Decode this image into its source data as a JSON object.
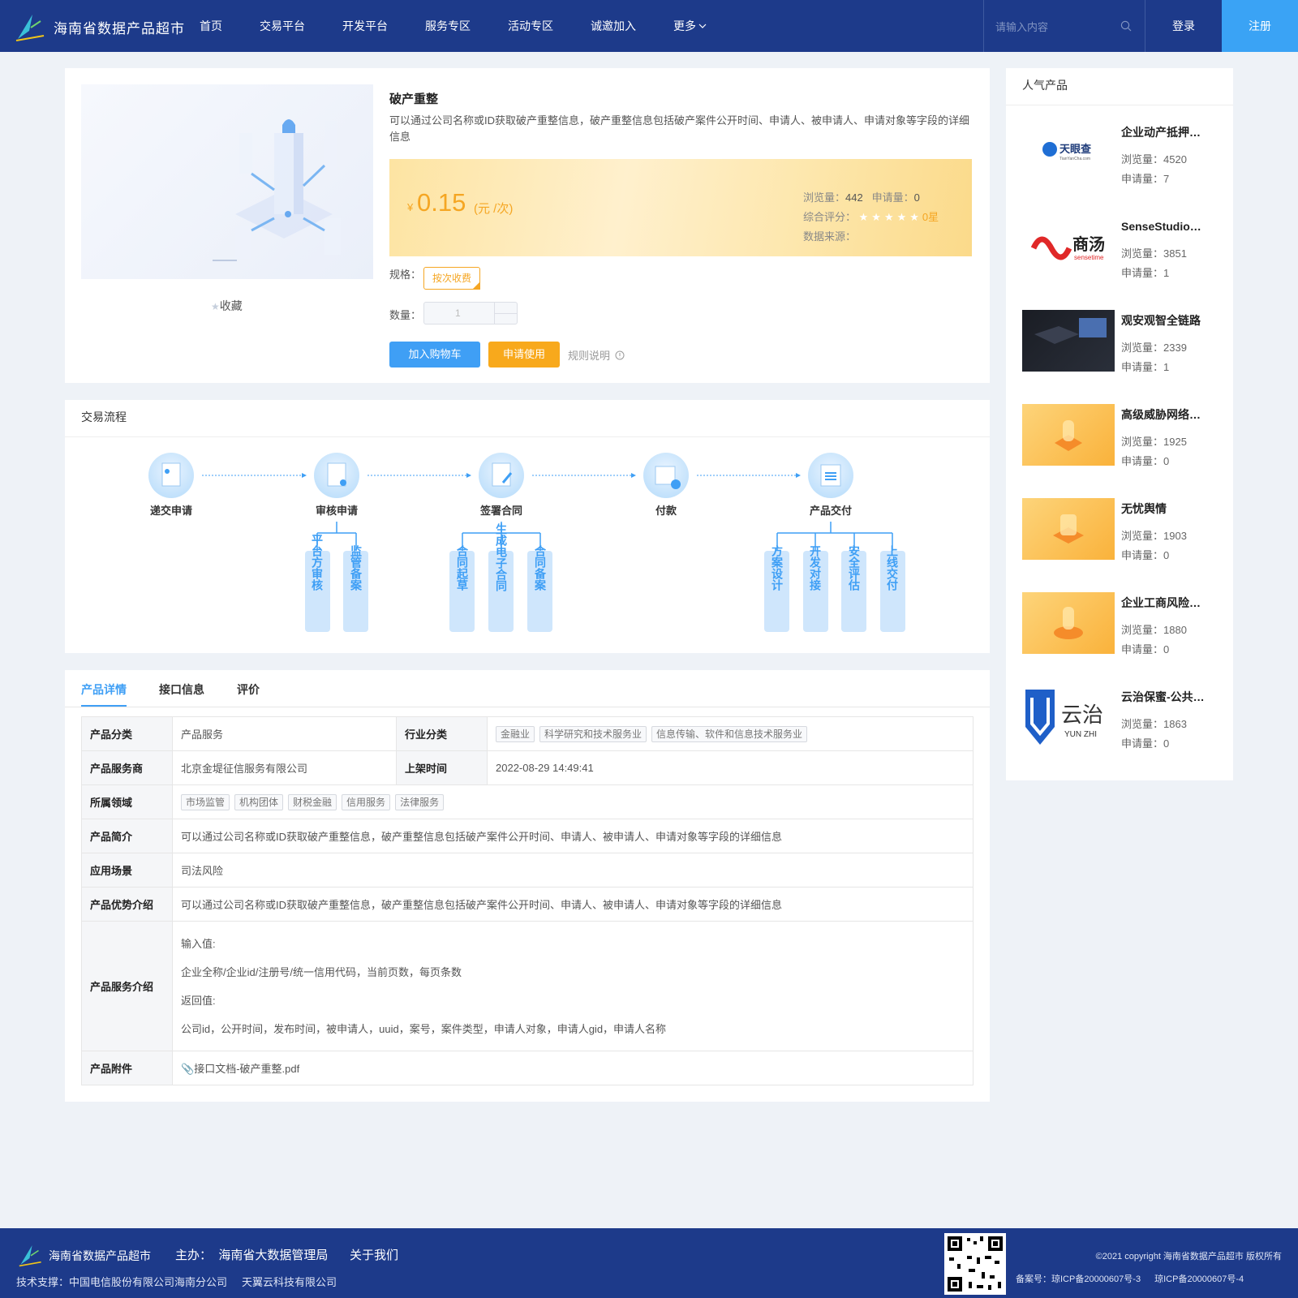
{
  "header": {
    "site_name": "海南省数据产品超市",
    "nav": [
      "首页",
      "交易平台",
      "开发平台",
      "服务专区",
      "活动专区",
      "诚邀加入",
      "更多"
    ],
    "search_placeholder": "请输入内容",
    "login": "登录",
    "register": "注册"
  },
  "product": {
    "title": "破产重整",
    "description": "可以通过公司名称或ID获取破产重整信息，破产重整信息包括破产案件公开时间、申请人、被申请人、申请对象等字段的详细信息",
    "favorite": "收藏",
    "currency": "¥",
    "price": "0.15",
    "unit": "(元 /次)",
    "views_label": "浏览量：",
    "views": "442",
    "applies_label": "申请量：",
    "applies": "0",
    "rating_label": "综合评分：",
    "rating": "0星",
    "source_label": "数据来源：",
    "spec_label": "规格：",
    "spec_value": "按次收费",
    "qty_label": "数量：",
    "qty_value": "1",
    "add_cart": "加入购物车",
    "apply": "申请使用",
    "rules": "规则说明"
  },
  "process": {
    "title": "交易流程",
    "steps": [
      "递交申请",
      "审核申请",
      "签署合同",
      "付款",
      "产品交付"
    ],
    "substeps": [
      "平台方审核",
      "监管备案",
      "合同起草",
      "生成电子合同",
      "合同备案",
      "方案设计",
      "开发对接",
      "安全评估",
      "上线交付"
    ]
  },
  "tabs": [
    "产品详情",
    "接口信息",
    "评价"
  ],
  "details": {
    "category_label": "产品分类",
    "category": "产品服务",
    "industry_label": "行业分类",
    "industry_tags": [
      "金融业",
      "科学研究和技术服务业",
      "信息传输、软件和信息技术服务业"
    ],
    "provider_label": "产品服务商",
    "provider": "北京金堤征信服务有限公司",
    "listed_label": "上架时间",
    "listed": "2022-08-29 14:49:41",
    "domain_label": "所属领域",
    "domain_tags": [
      "市场监管",
      "机构团体",
      "财税金融",
      "信用服务",
      "法律服务"
    ],
    "intro_label": "产品简介",
    "intro": "可以通过公司名称或ID获取破产重整信息，破产重整信息包括破产案件公开时间、申请人、被申请人、申请对象等字段的详细信息",
    "scene_label": "应用场景",
    "scene": "司法风险",
    "advantage_label": "产品优势介绍",
    "advantage": "可以通过公司名称或ID获取破产重整信息，破产重整信息包括破产案件公开时间、申请人、被申请人、申请对象等字段的详细信息",
    "service_label": "产品服务介绍",
    "service_lines": [
      "输入值:",
      "企业全称/企业id/注册号/统一信用代码，当前页数，每页条数",
      "返回值:",
      "公司id，公开时间，发布时间，被申请人，uuid，案号，案件类型，申请人对象，申请人gid，申请人名称"
    ],
    "attach_label": "产品附件",
    "attach": "接口文档-破产重整.pdf"
  },
  "popular": {
    "title": "人气产品",
    "views_label": "浏览量：",
    "applies_label": "申请量：",
    "items": [
      {
        "name": "企业动产抵押信息",
        "views": "4520",
        "applies": "7",
        "logo_text": "天眼查",
        "logo_sub": "TianYanCha.com"
      },
      {
        "name": "SenseStudio产品",
        "views": "3851",
        "applies": "1",
        "logo_text": "商汤",
        "logo_sub": "sensetime"
      },
      {
        "name": "观安观智全链路",
        "views": "2339",
        "applies": "1"
      },
      {
        "name": "高级威胁网络检测",
        "views": "1925",
        "applies": "0"
      },
      {
        "name": "无忧舆情",
        "views": "1903",
        "applies": "0"
      },
      {
        "name": "企业工商风险查询",
        "views": "1880",
        "applies": "0"
      },
      {
        "name": "云治保蜜-公共数据",
        "views": "1863",
        "applies": "0",
        "logo_text": "云治",
        "logo_sub": "YUN ZHI"
      }
    ]
  },
  "footer": {
    "site_name": "海南省数据产品超市",
    "host": "主办：  海南省大数据管理局",
    "about": "关于我们",
    "support": "技术支撑：中国电信股份有限公司海南分公司     天翼云科技有限公司",
    "copyright": "©2021 copyright 海南省数据产品超市 版权所有",
    "icp": "备案号：琼ICP备20000607号-3 琼ICP备20000607号-4"
  },
  "colors": {
    "nav_bg": "#1d3a8a",
    "accent": "#3f9ff5",
    "price": "#f5a623"
  }
}
